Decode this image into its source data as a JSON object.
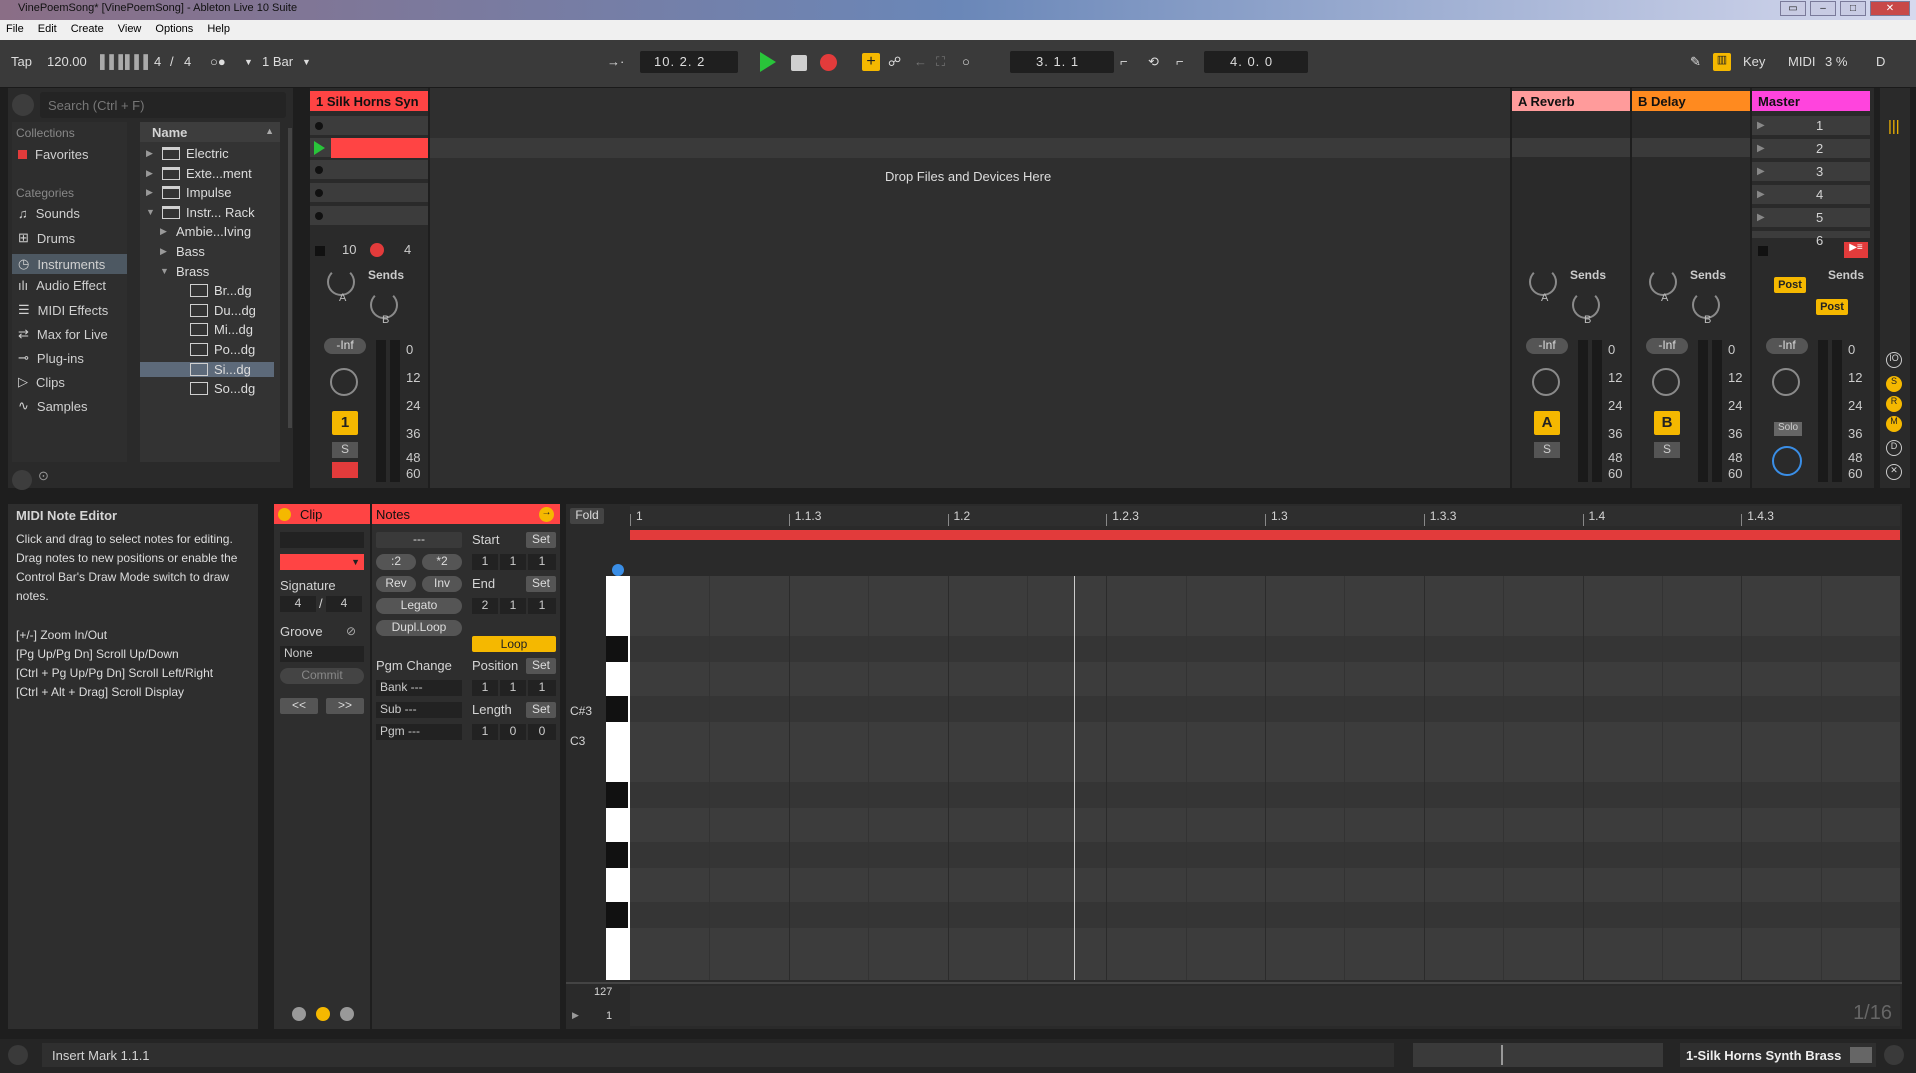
{
  "window": {
    "title": "VinePoemSong* [VinePoemSong] - Ableton Live 10 Suite"
  },
  "menu": [
    "File",
    "Edit",
    "Create",
    "View",
    "Options",
    "Help"
  ],
  "transport": {
    "tap": "Tap",
    "tempo": "120.00",
    "sig_num": "4",
    "sig_slash": "/",
    "sig_den": "4",
    "quant": "1 Bar",
    "position": "10.  2.  2",
    "loop_start": "3.  1.  1",
    "loop_length": "4.  0.  0",
    "key": "Key",
    "midi": "MIDI",
    "cpu": "3 %",
    "d": "D"
  },
  "browser": {
    "search_placeholder": "Search (Ctrl + F)",
    "collections_label": "Collections",
    "favorites": "Favorites",
    "categories_label": "Categories",
    "categories": [
      "Sounds",
      "Drums",
      "Instruments",
      "Audio Effect",
      "MIDI Effects",
      "Max for Live",
      "Plug-ins",
      "Clips",
      "Samples"
    ],
    "name_header": "Name",
    "files": [
      {
        "label": "Electric",
        "kind": "folder",
        "depth": 0,
        "expanded": false
      },
      {
        "label": "Exte...ment",
        "kind": "folder",
        "depth": 0,
        "expanded": false
      },
      {
        "label": "Impulse",
        "kind": "folder",
        "depth": 0,
        "expanded": false
      },
      {
        "label": "Instr... Rack",
        "kind": "folder",
        "depth": 0,
        "expanded": true
      },
      {
        "label": "Ambie...Iving",
        "kind": "sub",
        "depth": 1,
        "expanded": false
      },
      {
        "label": "Bass",
        "kind": "sub",
        "depth": 1,
        "expanded": false
      },
      {
        "label": "Brass",
        "kind": "sub",
        "depth": 1,
        "expanded": true
      },
      {
        "label": "Br...dg",
        "kind": "preset",
        "depth": 2
      },
      {
        "label": "Du...dg",
        "kind": "preset",
        "depth": 2
      },
      {
        "label": "Mi...dg",
        "kind": "preset",
        "depth": 2
      },
      {
        "label": "Po...dg",
        "kind": "preset",
        "depth": 2
      },
      {
        "label": "Si...dg",
        "kind": "preset",
        "depth": 2,
        "selected": true
      },
      {
        "label": "So...dg",
        "kind": "preset",
        "depth": 2
      }
    ]
  },
  "session": {
    "track1": "1 Silk Horns Syn",
    "drop_text": "Drop Files and Devices Here",
    "track_a": "A Reverb",
    "track_b": "B Delay",
    "master": "Master",
    "scenes": [
      "1",
      "2",
      "3",
      "4",
      "5",
      "6"
    ],
    "track1_val1": "10",
    "track1_val2": "4",
    "sends": "Sends",
    "send_a": "A",
    "send_b": "B",
    "inf": "-Inf",
    "track_num": "1",
    "solo": "S",
    "post": "Post",
    "solo_label": "Solo",
    "meter_scale": [
      "0",
      "12",
      "24",
      "36",
      "48",
      "60"
    ]
  },
  "info": {
    "title": "MIDI Note Editor",
    "body": "Click and drag to select notes for editing. Drag notes to new positions or enable the Control Bar's Draw Mode switch to draw notes.",
    "shortcuts": [
      "[+/-] Zoom In/Out",
      "[Pg Up/Pg Dn] Scroll Up/Down",
      "[Ctrl + Pg Up/Pg Dn] Scroll Left/Right",
      "[Ctrl + Alt + Drag] Scroll Display"
    ]
  },
  "clip": {
    "title": "Clip",
    "signature_label": "Signature",
    "sig_num": "4",
    "sig_den": "4",
    "groove_label": "Groove",
    "groove_value": "None",
    "commit": "Commit",
    "prev": "<<",
    "next": ">>"
  },
  "notes": {
    "title": "Notes",
    "dash": "---",
    "half": ":2",
    "double": "*2",
    "rev": "Rev",
    "inv": "Inv",
    "legato": "Legato",
    "dupl": "Dupl.Loop",
    "start": "Start",
    "end": "End",
    "set": "Set",
    "start_vals": [
      "1",
      "1",
      "1"
    ],
    "end_vals": [
      "2",
      "1",
      "1"
    ],
    "loop": "Loop",
    "position": "Position",
    "pos_vals": [
      "1",
      "1",
      "1"
    ],
    "length": "Length",
    "len_vals": [
      "1",
      "0",
      "0"
    ],
    "pgm_change": "Pgm Change",
    "bank": "Bank ---",
    "sub": "Sub ---",
    "pgm": "Pgm ---"
  },
  "editor": {
    "fold": "Fold",
    "ruler": [
      "1",
      "1.1.3",
      "1.2",
      "1.2.3",
      "1.3",
      "1.3.3",
      "1.4",
      "1.4.3"
    ],
    "c_sharp3": "C#3",
    "c3": "C3",
    "vel_max": "127",
    "vel_min": "1",
    "grid": "1/16"
  },
  "status": {
    "text": "Insert Mark 1.1.1",
    "track": "1-Silk Horns Synth Brass"
  },
  "colors": {
    "track_red": "#ff4444",
    "reverb": "#ff9b9b",
    "delay": "#ff8a1f",
    "master": "#ff44dd",
    "yellow": "#f5b800",
    "play": "#29c43a",
    "record": "#e23b3b"
  }
}
